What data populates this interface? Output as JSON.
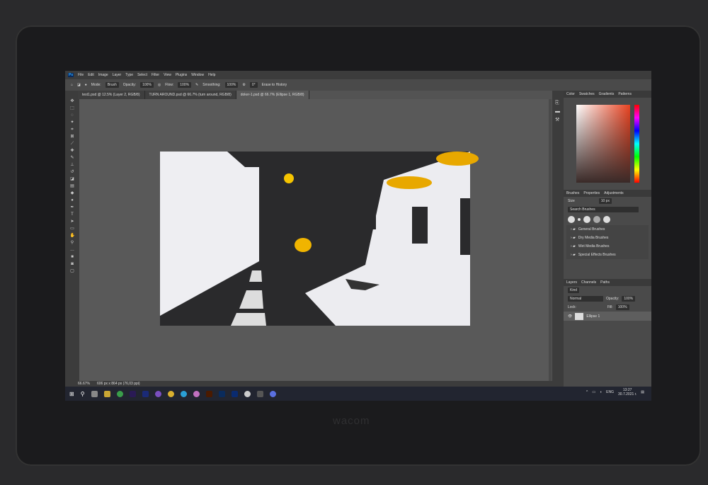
{
  "device": {
    "brand": "wacom"
  },
  "menu": [
    "File",
    "Edit",
    "Image",
    "Layer",
    "Type",
    "Select",
    "Filter",
    "View",
    "Plugins",
    "Window",
    "Help"
  ],
  "options": {
    "mode_label": "Mode:",
    "mode": "Brush",
    "opacity_label": "Opacity:",
    "opacity": "100%",
    "flow_label": "Flow:",
    "flow": "100%",
    "smoothing_label": "Smoothing:",
    "smoothing": "100%",
    "angle": "0°",
    "erase_history": "Erase to History"
  },
  "tabs": [
    "test1.psd @ 12.5% (Layer 2, RGB/8)",
    "TURN AROUND.psd @ 66.7% (turn around, RGB/8)",
    "doker-1.psd @ 66.7% (Ellipse 1, RGB/8)"
  ],
  "status": {
    "zoom": "66.67%",
    "doc": "606 px x 864 px (76,03 ppi)"
  },
  "color_panel": {
    "tabs": [
      "Color",
      "Swatches",
      "Gradients",
      "Patterns"
    ],
    "accent": "#e84220"
  },
  "brushes_panel": {
    "tabs": [
      "Brushes",
      "Properties",
      "Adjustments"
    ],
    "size_label": "Size",
    "size": "10 px",
    "search_placeholder": "Search Brushes",
    "folders": [
      "General Brushes",
      "Dry Media Brushes",
      "Wet Media Brushes",
      "Special Effects Brushes"
    ]
  },
  "layers_panel": {
    "tabs": [
      "Layers",
      "Channels",
      "Paths"
    ],
    "filter": "Kind",
    "blend": "Normal",
    "opacity_label": "Opacity:",
    "opacity": "100%",
    "lock_label": "Lock:",
    "fill_label": "Fill:",
    "fill": "100%",
    "layers": [
      "Ellipse 1"
    ]
  },
  "taskbar": {
    "lang": "ENG",
    "time": "13:27",
    "date": "30.7.2021 г."
  }
}
